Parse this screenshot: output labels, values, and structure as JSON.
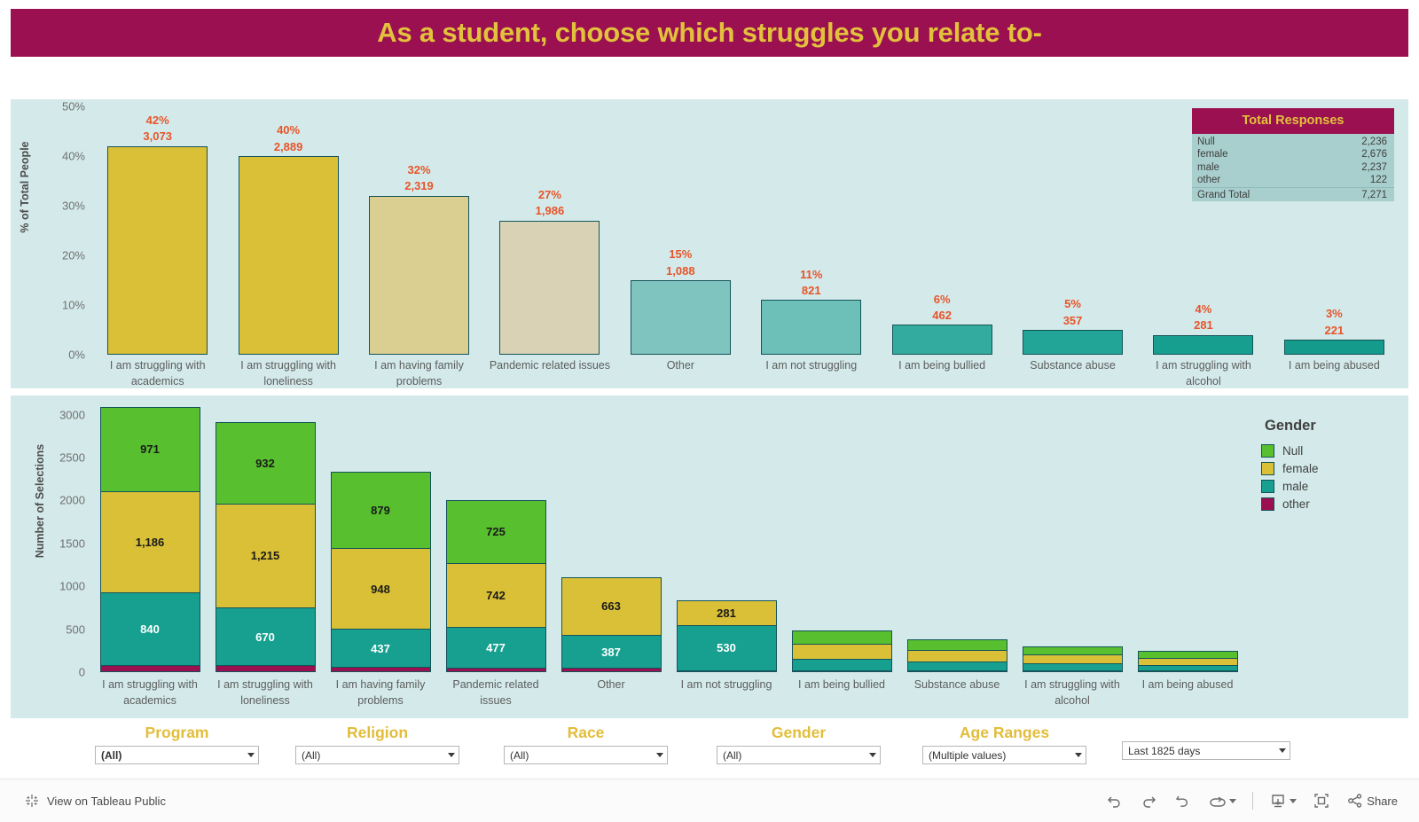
{
  "header": {
    "title": "As a student, choose which struggles you relate to-"
  },
  "colors": {
    "title_bg": "#9b1050",
    "title_text": "#e2c13c",
    "panel_bg": "#d4eaea",
    "label_orange": "#e8542a",
    "filter_title": "#e2bd3a",
    "bar_outline": "#14545a"
  },
  "total_responses": {
    "title": "Total Responses",
    "rows": [
      {
        "label": "Null",
        "value": "2,236"
      },
      {
        "label": "female",
        "value": "2,676"
      },
      {
        "label": "male",
        "value": "2,237"
      },
      {
        "label": "other",
        "value": "122"
      }
    ],
    "total": {
      "label": "Grand Total",
      "value": "7,271"
    }
  },
  "chart_data": [
    {
      "type": "bar",
      "title": "",
      "ylabel": "% of Total People",
      "xlabel": "",
      "ylim": [
        0,
        50
      ],
      "yticks": [
        "0%",
        "10%",
        "20%",
        "30%",
        "40%",
        "50%"
      ],
      "grid": false,
      "categories": [
        "I am struggling with academics",
        "I am struggling with loneliness",
        "I am having family problems",
        "Pandemic related issues",
        "Other",
        "I am not struggling",
        "I am being bullied",
        "Substance abuse",
        "I am struggling with alcohol",
        "I am being abused"
      ],
      "values": [
        42,
        40,
        32,
        27,
        15,
        11,
        6,
        5,
        4,
        3
      ],
      "counts": [
        "3,073",
        "2,889",
        "2,319",
        "1,986",
        "1,088",
        "821",
        "462",
        "357",
        "281",
        "221"
      ],
      "percent_labels": [
        "42%",
        "40%",
        "32%",
        "27%",
        "15%",
        "11%",
        "6%",
        "5%",
        "4%",
        "3%"
      ],
      "bar_colors": [
        "#d9c036",
        "#d9c036",
        "#dacf91",
        "#d9d2b4",
        "#80c4c0",
        "#6dc0b8",
        "#33ab9e",
        "#22a596",
        "#169e8e",
        "#149b8b"
      ]
    },
    {
      "type": "bar",
      "stacked": true,
      "title": "",
      "ylabel": "Number of Selections",
      "xlabel": "",
      "ylim": [
        0,
        3100
      ],
      "yticks": [
        "0",
        "500",
        "1000",
        "1500",
        "2000",
        "2500",
        "3000"
      ],
      "grid": false,
      "legend_title": "Gender",
      "legend_position": "right",
      "categories": [
        "I am struggling with academics",
        "I am struggling with loneliness",
        "I am having family problems",
        "Pandemic related issues",
        "Other",
        "I am not struggling",
        "I am being bullied",
        "Substance abuse",
        "I am struggling with alcohol",
        "I am being abused"
      ],
      "series": [
        {
          "name": "Null",
          "color": "#58bf2e",
          "values": [
            971,
            932,
            879,
            725,
            0,
            0,
            143,
            112,
            88,
            70
          ],
          "labels": [
            "971",
            "932",
            "879",
            "725",
            "",
            "",
            "",
            "",
            "",
            ""
          ]
        },
        {
          "name": "female",
          "color": "#d9c036",
          "values": [
            1186,
            1215,
            948,
            742,
            663,
            281,
            171,
            131,
            103,
            82
          ],
          "labels": [
            "1,186",
            "1,215",
            "948",
            "742",
            "663",
            "281",
            "",
            "",
            "",
            ""
          ]
        },
        {
          "name": "male",
          "color": "#17a08f",
          "values": [
            840,
            670,
            437,
            477,
            387,
            530,
            136,
            105,
            82,
            62
          ],
          "labels": [
            "840",
            "670",
            "437",
            "477",
            "387",
            "530",
            "",
            "",
            "",
            ""
          ]
        },
        {
          "name": "other",
          "color": "#9b1050",
          "values": [
            76,
            72,
            55,
            42,
            38,
            10,
            12,
            9,
            8,
            7
          ],
          "labels": [
            "",
            "",
            "",
            "",
            "",
            "",
            "",
            "",
            "",
            ""
          ]
        }
      ]
    }
  ],
  "legend": {
    "title": "Gender",
    "items": [
      {
        "label": "Null",
        "color": "#58bf2e"
      },
      {
        "label": "female",
        "color": "#d9c036"
      },
      {
        "label": "male",
        "color": "#17a08f"
      },
      {
        "label": "other",
        "color": "#9b1050"
      }
    ]
  },
  "filters": [
    {
      "title": "Program",
      "value": "(All)",
      "bold": true
    },
    {
      "title": "Religion",
      "value": "(All)",
      "bold": false
    },
    {
      "title": "Race",
      "value": "(All)",
      "bold": false
    },
    {
      "title": "Gender",
      "value": "(All)",
      "bold": false
    },
    {
      "title": "Age Ranges",
      "value": "(Multiple values)",
      "bold": false
    }
  ],
  "date_filter": {
    "value": "Last 1825 days"
  },
  "toolbar": {
    "view_on_tableau": "View on Tableau Public",
    "share_label": "Share",
    "undo_label": "Undo",
    "redo_label": "Redo",
    "revert_label": "Revert",
    "refresh_label": "Refresh",
    "download_label": "Download",
    "fullscreen_label": "Full Screen"
  }
}
